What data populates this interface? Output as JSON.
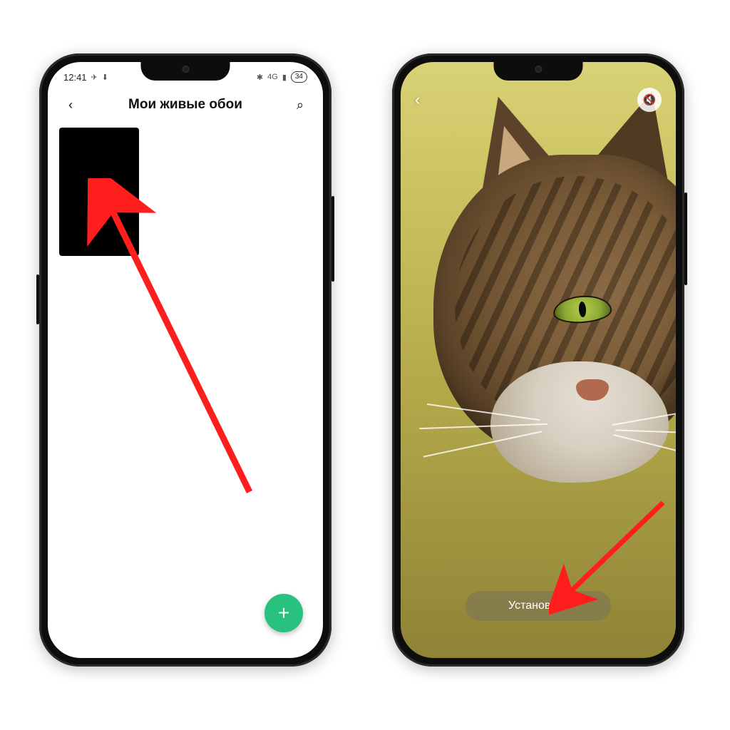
{
  "status": {
    "time": "12:41",
    "network_label": "4G",
    "battery_percent": "34"
  },
  "left": {
    "title": "Мои живые обои",
    "fab_label": "+"
  },
  "right": {
    "apply_label": "Установить"
  },
  "icons": {
    "back": "‹",
    "search": "⌕",
    "plane": "✈",
    "down": "⬇",
    "bt": "✱",
    "signal": "▮",
    "mute": "🔇"
  }
}
